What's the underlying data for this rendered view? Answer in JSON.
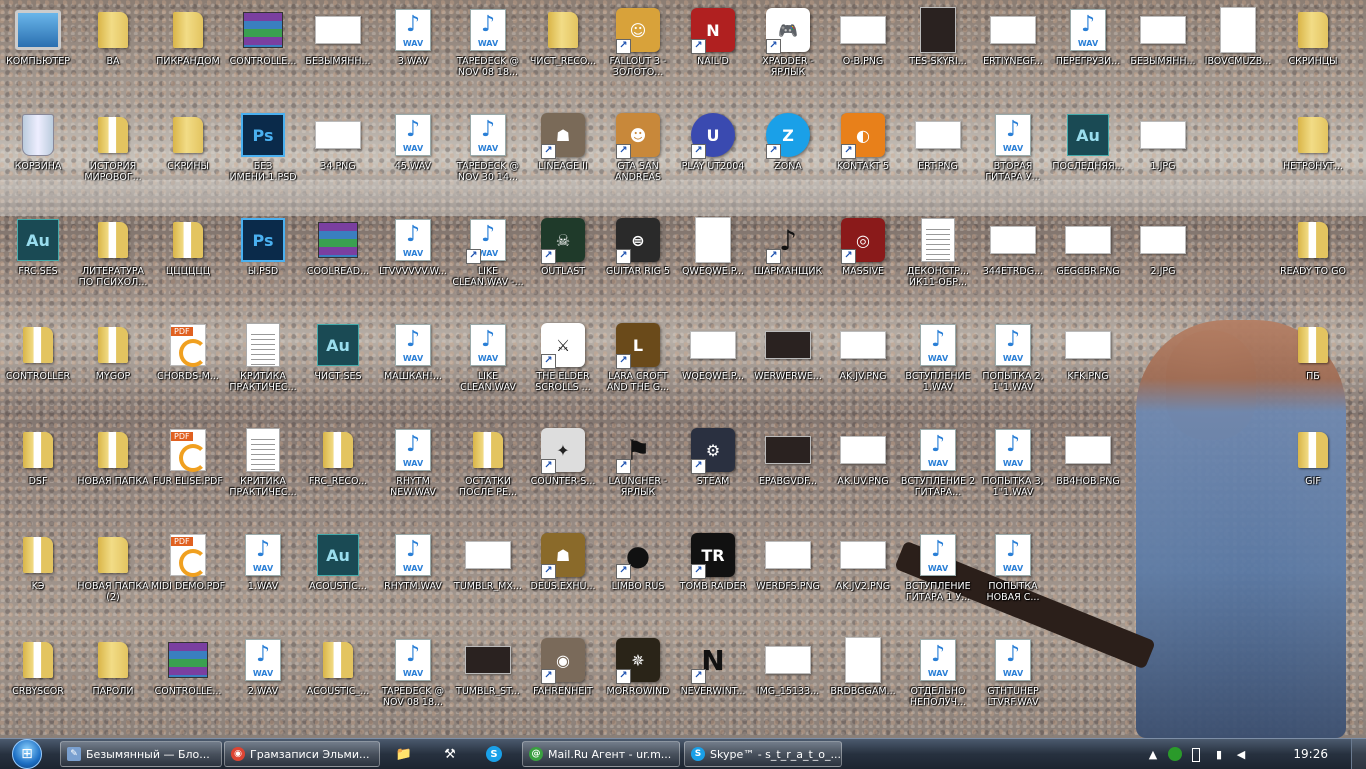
{
  "desktop": {
    "icons": [
      {
        "label": "КОМПЬЮТЕР",
        "kind": "computer",
        "col": 0,
        "row": 0
      },
      {
        "label": "ВА",
        "kind": "folder",
        "col": 1,
        "row": 0
      },
      {
        "label": "ПИКРАНДОМ",
        "kind": "folder",
        "col": 2,
        "row": 0
      },
      {
        "label": "CONTROLLE...",
        "kind": "rar",
        "col": 3,
        "row": 0
      },
      {
        "label": "БЕЗЫМЯНН...",
        "kind": "thumb",
        "col": 4,
        "row": 0
      },
      {
        "label": "3.WAV",
        "kind": "wav",
        "col": 5,
        "row": 0
      },
      {
        "label": "TAPEDECK @ NOV 08 18...",
        "kind": "wav",
        "col": 6,
        "row": 0
      },
      {
        "label": "ЧИСТ_RECO...",
        "kind": "folder",
        "col": 7,
        "row": 0
      },
      {
        "label": "FALLOUT 3 - ЗОЛОТО...",
        "kind": "app",
        "color": "#d8a23a",
        "glyph": "☺",
        "shortcut": true,
        "col": 8,
        "row": 0
      },
      {
        "label": "NAIL'D",
        "kind": "app",
        "color": "#b02020",
        "glyph": "N",
        "shortcut": true,
        "col": 9,
        "row": 0
      },
      {
        "label": "XPADDER - ЯРЛЫК",
        "kind": "app",
        "color": "#ffffff",
        "glyph": "🎮",
        "shortcut": true,
        "col": 10,
        "row": 0
      },
      {
        "label": "O-B.PNG",
        "kind": "thumb",
        "col": 11,
        "row": 0
      },
      {
        "label": "TES-SKYRI...",
        "kind": "thumb",
        "tall": true,
        "dark": true,
        "col": 12,
        "row": 0
      },
      {
        "label": "ERTIYNEGF...",
        "kind": "thumb",
        "col": 13,
        "row": 0
      },
      {
        "label": "ПЕРЕГРУЗИ...",
        "kind": "wav",
        "col": 14,
        "row": 0
      },
      {
        "label": "БЕЗЫМЯНН...",
        "kind": "thumb",
        "col": 15,
        "row": 0
      },
      {
        "label": "IBOVCMUZB...",
        "kind": "thumb",
        "tall": true,
        "col": 16,
        "row": 0
      },
      {
        "label": "СКРИНЦЫ",
        "kind": "folder",
        "col": 17,
        "row": 0
      },
      {
        "label": "КОРЗИНА",
        "kind": "bin",
        "col": 0,
        "row": 1
      },
      {
        "label": "ИСТОРИЯ МИРОВОГ...",
        "kind": "folder",
        "doc": true,
        "col": 1,
        "row": 1
      },
      {
        "label": "СКРИНЫ",
        "kind": "folder",
        "col": 2,
        "row": 1
      },
      {
        "label": "БЕЗ ИМЕНИ-1.PSD",
        "kind": "psd",
        "col": 3,
        "row": 1
      },
      {
        "label": "34.PNG",
        "kind": "thumb",
        "col": 4,
        "row": 1
      },
      {
        "label": "45.WAV",
        "kind": "wav",
        "col": 5,
        "row": 1
      },
      {
        "label": "TAPEDECK @ NOV 30 14...",
        "kind": "wav",
        "col": 6,
        "row": 1
      },
      {
        "label": "LINEAGE II",
        "kind": "app",
        "color": "#7a6a58",
        "glyph": "☗",
        "shortcut": true,
        "col": 7,
        "row": 1
      },
      {
        "label": "GTA SAN ANDREAS",
        "kind": "app",
        "color": "#c8883a",
        "glyph": "☻",
        "shortcut": true,
        "col": 8,
        "row": 1
      },
      {
        "label": "PLAY UT2004",
        "kind": "app",
        "color": "#3a4ab0",
        "glyph": "U",
        "shortcut": true,
        "round": true,
        "col": 9,
        "row": 1
      },
      {
        "label": "ZONA",
        "kind": "app",
        "color": "#1aa0e8",
        "glyph": "Z",
        "shortcut": true,
        "round": true,
        "col": 10,
        "row": 1
      },
      {
        "label": "KONTAKT 5",
        "kind": "app",
        "color": "#e8801a",
        "glyph": "◐",
        "shortcut": true,
        "col": 11,
        "row": 1
      },
      {
        "label": "ERT.PNG",
        "kind": "thumb",
        "col": 12,
        "row": 1
      },
      {
        "label": "ВТОРАЯ ГИТАРА У...",
        "kind": "wav",
        "col": 13,
        "row": 1
      },
      {
        "label": "ПОСЛЕДНЯЯ...",
        "kind": "ses",
        "col": 14,
        "row": 1
      },
      {
        "label": "1.JPG",
        "kind": "thumb",
        "col": 15,
        "row": 1
      },
      {
        "label": "НЕТРОНУТ...",
        "kind": "folder",
        "col": 17,
        "row": 1
      },
      {
        "label": "FRC.SES",
        "kind": "ses",
        "col": 0,
        "row": 2
      },
      {
        "label": "ЛИТЕРАТУРА ПО ПСИХОЛ...",
        "kind": "folder",
        "doc": true,
        "col": 1,
        "row": 2
      },
      {
        "label": "ЦЦЦЦЦЦ",
        "kind": "folder",
        "doc": true,
        "col": 2,
        "row": 2
      },
      {
        "label": "Ы.PSD",
        "kind": "psd",
        "col": 3,
        "row": 2
      },
      {
        "label": "COOLREAD...",
        "kind": "rar",
        "col": 4,
        "row": 2
      },
      {
        "label": "LTVVVVVV.W...",
        "kind": "wav",
        "col": 5,
        "row": 2
      },
      {
        "label": "LIKE CLEAN.WAV -...",
        "kind": "wav",
        "shortcut": true,
        "col": 6,
        "row": 2
      },
      {
        "label": "OUTLAST",
        "kind": "app",
        "color": "#1f3a2a",
        "glyph": "☠",
        "shortcut": true,
        "col": 7,
        "row": 2
      },
      {
        "label": "GUITAR RIG 5",
        "kind": "app",
        "color": "#2a2a2a",
        "glyph": "⊜",
        "shortcut": true,
        "col": 8,
        "row": 2
      },
      {
        "label": "QWEQWE.P...",
        "kind": "thumb",
        "tall": true,
        "col": 9,
        "row": 2
      },
      {
        "label": "ШАРМАНЩИК",
        "kind": "app",
        "color": "transparent",
        "glyph": "♪",
        "shortcut": true,
        "col": 10,
        "row": 2
      },
      {
        "label": "MASSIVE",
        "kind": "app",
        "color": "#8a1a1a",
        "glyph": "◎",
        "shortcut": true,
        "col": 11,
        "row": 2
      },
      {
        "label": "ДЕКОНСТР... ИК11-ОБР...",
        "kind": "doc",
        "col": 12,
        "row": 2
      },
      {
        "label": "344ETRDG...",
        "kind": "thumb",
        "col": 13,
        "row": 2
      },
      {
        "label": "GEGCBR.PNG",
        "kind": "thumb",
        "col": 14,
        "row": 2
      },
      {
        "label": "2.JPG",
        "kind": "thumb",
        "col": 15,
        "row": 2
      },
      {
        "label": "READY TO GO",
        "kind": "folder",
        "doc": true,
        "col": 17,
        "row": 2
      },
      {
        "label": "CONTROLLER",
        "kind": "folder",
        "doc": true,
        "col": 0,
        "row": 3
      },
      {
        "label": "MYGOP",
        "kind": "folder",
        "doc": true,
        "col": 1,
        "row": 3
      },
      {
        "label": "CHORDS-M...",
        "kind": "pdf",
        "col": 2,
        "row": 3
      },
      {
        "label": "КРИТИКА ПРАКТИЧЕС...",
        "kind": "doc",
        "col": 3,
        "row": 3
      },
      {
        "label": "ЧИСТ.SES",
        "kind": "ses",
        "col": 4,
        "row": 3
      },
      {
        "label": "МАШКАН!...",
        "kind": "wav",
        "col": 5,
        "row": 3
      },
      {
        "label": "LIKE CLEAN.WAV",
        "kind": "wav",
        "col": 6,
        "row": 3
      },
      {
        "label": "THE ELDER SCROLLS ...",
        "kind": "app",
        "color": "#ffffff",
        "glyph": "⚔",
        "shortcut": true,
        "col": 7,
        "row": 3
      },
      {
        "label": "LARA CROFT AND THE G...",
        "kind": "app",
        "color": "#6a4a1a",
        "glyph": "L",
        "shortcut": true,
        "col": 8,
        "row": 3
      },
      {
        "label": "WQEQWE.P...",
        "kind": "thumb",
        "col": 9,
        "row": 3
      },
      {
        "label": "WERWERWE...",
        "kind": "thumb",
        "dark": true,
        "col": 10,
        "row": 3
      },
      {
        "label": "AK.JV.PNG",
        "kind": "thumb",
        "col": 11,
        "row": 3
      },
      {
        "label": "ВСТУПЛЕНИЕ 1.WAV",
        "kind": "wav",
        "col": 12,
        "row": 3
      },
      {
        "label": "ПОПЫТКА 2, 1\"1.WAV",
        "kind": "wav",
        "col": 13,
        "row": 3
      },
      {
        "label": "KFK.PNG",
        "kind": "thumb",
        "col": 14,
        "row": 3
      },
      {
        "label": "ПБ",
        "kind": "folder",
        "doc": true,
        "col": 17,
        "row": 3
      },
      {
        "label": "DSF",
        "kind": "folder",
        "doc": true,
        "col": 0,
        "row": 4
      },
      {
        "label": "НОВАЯ ПАПКА",
        "kind": "folder",
        "doc": true,
        "col": 1,
        "row": 4
      },
      {
        "label": "FUR ELISE.PDF",
        "kind": "pdf",
        "col": 2,
        "row": 4
      },
      {
        "label": "КРИТИКА ПРАКТИЧЕС...",
        "kind": "doc",
        "col": 3,
        "row": 4
      },
      {
        "label": "FRC_RECO...",
        "kind": "folder",
        "doc": true,
        "col": 4,
        "row": 4
      },
      {
        "label": "RHYTM NEW.WAV",
        "kind": "wav",
        "col": 5,
        "row": 4
      },
      {
        "label": "ОСТАТКИ ПОСЛЕ РЕ...",
        "kind": "folder",
        "doc": true,
        "col": 6,
        "row": 4
      },
      {
        "label": "COUNTER-S...",
        "kind": "app",
        "color": "#dddddd",
        "glyph": "✦",
        "shortcut": true,
        "col": 7,
        "row": 4
      },
      {
        "label": "LAUNCHER - ЯРЛЫК",
        "kind": "app",
        "color": "transparent",
        "glyph": "⚑",
        "shortcut": true,
        "col": 8,
        "row": 4
      },
      {
        "label": "STEAM",
        "kind": "app",
        "color": "#2a3040",
        "glyph": "⚙",
        "shortcut": true,
        "col": 9,
        "row": 4
      },
      {
        "label": "EPABGVDF...",
        "kind": "thumb",
        "dark": true,
        "col": 10,
        "row": 4
      },
      {
        "label": "AK.UV.PNG",
        "kind": "thumb",
        "col": 11,
        "row": 4
      },
      {
        "label": "ВСТУПЛЕНИЕ 2 ГИТАРА...",
        "kind": "wav",
        "col": 12,
        "row": 4
      },
      {
        "label": "ПОПЫТКА 3, 1\"1.WAV",
        "kind": "wav",
        "col": 13,
        "row": 4
      },
      {
        "label": "BB4HOB.PNG",
        "kind": "thumb",
        "col": 14,
        "row": 4
      },
      {
        "label": "GIF",
        "kind": "folder",
        "doc": true,
        "col": 17,
        "row": 4
      },
      {
        "label": "KЭ",
        "kind": "folder",
        "doc": true,
        "col": 0,
        "row": 5
      },
      {
        "label": "НОВАЯ ПАПКА (2)",
        "kind": "folder",
        "col": 1,
        "row": 5
      },
      {
        "label": "MIDI DEMO.PDF",
        "kind": "pdf",
        "col": 2,
        "row": 5
      },
      {
        "label": "1.WAV",
        "kind": "wav",
        "col": 3,
        "row": 5
      },
      {
        "label": "ACOUSTIC...",
        "kind": "ses",
        "col": 4,
        "row": 5
      },
      {
        "label": "RHYTM.WAV",
        "kind": "wav",
        "col": 5,
        "row": 5
      },
      {
        "label": "TUMBLR_MX...",
        "kind": "thumb",
        "col": 6,
        "row": 5
      },
      {
        "label": "DEUS.EXHU...",
        "kind": "app",
        "color": "#8a6a2a",
        "glyph": "☗",
        "shortcut": true,
        "col": 7,
        "row": 5
      },
      {
        "label": "LIMBO RUS",
        "kind": "app",
        "color": "transparent",
        "glyph": "●",
        "shortcut": true,
        "col": 8,
        "row": 5
      },
      {
        "label": "TOMB RAIDER",
        "kind": "app",
        "color": "#111111",
        "glyph": "TR",
        "shortcut": true,
        "col": 9,
        "row": 5
      },
      {
        "label": "WERDFS.PNG",
        "kind": "thumb",
        "col": 10,
        "row": 5
      },
      {
        "label": "AK.JV2.PNG",
        "kind": "thumb",
        "col": 11,
        "row": 5
      },
      {
        "label": "ВСТУПЛЕНИЕ ГИТАРА 1 У...",
        "kind": "wav",
        "col": 12,
        "row": 5
      },
      {
        "label": "ПОПЫТКА НОВАЯ С...",
        "kind": "wav",
        "col": 13,
        "row": 5
      },
      {
        "label": "CRBYSCOR",
        "kind": "folder",
        "doc": true,
        "col": 0,
        "row": 6
      },
      {
        "label": "ПАРОЛИ",
        "kind": "folder",
        "col": 1,
        "row": 6
      },
      {
        "label": "CONTROLLE...",
        "kind": "rar",
        "col": 2,
        "row": 6
      },
      {
        "label": "2.WAV",
        "kind": "wav",
        "col": 3,
        "row": 6
      },
      {
        "label": "ACOUSTIC_...",
        "kind": "folder",
        "doc": true,
        "col": 4,
        "row": 6
      },
      {
        "label": "TAPEDECK @ NOV 08 18...",
        "kind": "wav",
        "col": 5,
        "row": 6
      },
      {
        "label": "TUMBLR_ST...",
        "kind": "thumb",
        "dark": true,
        "col": 6,
        "row": 6
      },
      {
        "label": "FAHRENHEIT",
        "kind": "app",
        "color": "#7a6a5a",
        "glyph": "◉",
        "shortcut": true,
        "col": 7,
        "row": 6
      },
      {
        "label": "MORROWIND",
        "kind": "app",
        "color": "#2a2418",
        "glyph": "✵",
        "shortcut": true,
        "col": 8,
        "row": 6
      },
      {
        "label": "NEVERWINT...",
        "kind": "app",
        "color": "transparent",
        "glyph": "N",
        "shortcut": true,
        "col": 9,
        "row": 6
      },
      {
        "label": "IMG_15133...",
        "kind": "thumb",
        "col": 10,
        "row": 6
      },
      {
        "label": "BRDBGGAM...",
        "kind": "thumb",
        "tall": true,
        "col": 11,
        "row": 6
      },
      {
        "label": "ОТДЕЛЬНО НЕПОЛУЧ...",
        "kind": "wav",
        "col": 12,
        "row": 6
      },
      {
        "label": "GTHTUHEP LTVRF.WAV",
        "kind": "wav",
        "col": 13,
        "row": 6
      }
    ]
  },
  "taskbar": {
    "start_glyph": "⊞",
    "tasks": [
      {
        "label": "Безымянный — Бло...",
        "icon_color": "#7aa0d0",
        "icon_glyph": "✎"
      },
      {
        "label": "Грамзаписи Эльми...",
        "icon_color": "#dd4433",
        "icon_glyph": "◉"
      },
      {
        "label": "Mail.Ru Агент - ur.m...",
        "icon_color": "#3aa040",
        "icon_glyph": "@"
      },
      {
        "label": "Skype™ - s_t_r_a_t_o_...",
        "icon_color": "#1aa0e8",
        "icon_glyph": "S"
      }
    ],
    "quick_launch": [
      {
        "name": "explorer",
        "glyph": "📁"
      },
      {
        "name": "tool",
        "glyph": "⚒"
      },
      {
        "name": "skype",
        "glyph": "S"
      }
    ],
    "clock": "19:26",
    "show_hidden_glyph": "▲"
  }
}
